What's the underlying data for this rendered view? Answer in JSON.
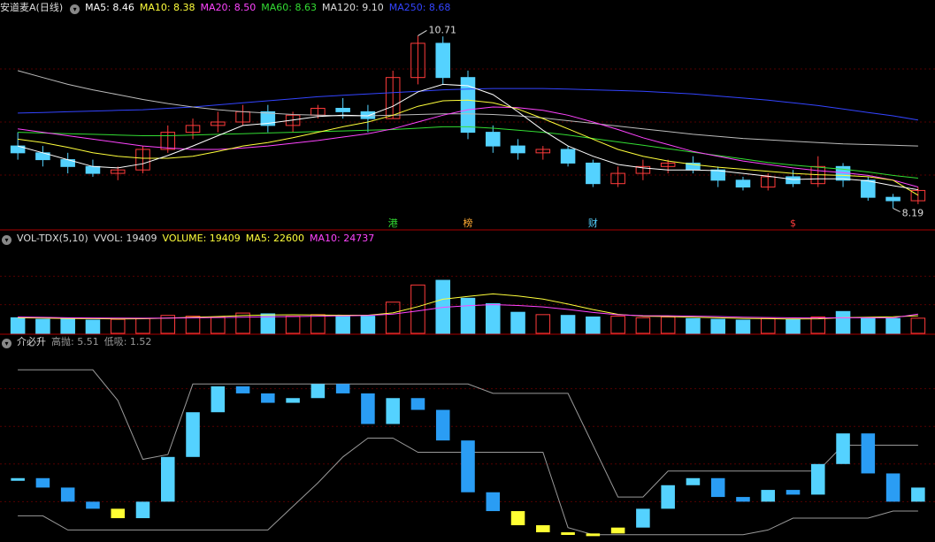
{
  "colors": {
    "up": "#ff3b3b",
    "down": "#54d2ff",
    "ma5": "#ffffff",
    "ma10": "#ffff3b",
    "ma20": "#ff44ff",
    "ma60": "#33dd33",
    "ma120": "#bbbbbb",
    "ma250": "#3344ff",
    "sep": "#aa0000",
    "grid": "#550000"
  },
  "main_header": {
    "title": "安道麦A(日线)",
    "ma5": "MA5: 8.46",
    "ma10": "MA10: 8.38",
    "ma20": "MA20: 8.50",
    "ma60": "MA60: 8.63",
    "ma120": "MA120: 9.10",
    "ma250": "MA250: 8.68"
  },
  "vol_header": {
    "title": "VOL-TDX(5,10)",
    "vvol": "VVOL: 19409",
    "volume": "VOLUME: 19409",
    "ma5": "MA5: 22600",
    "ma10": "MA10: 24737"
  },
  "ind_header": {
    "title": "介必升",
    "high": "高抛: 5.51",
    "low": "低吸: 1.52"
  },
  "markers": [
    {
      "label": "港",
      "color": "#33dd33",
      "index": 15
    },
    {
      "label": "榜",
      "color": "#ffaa33",
      "index": 18
    },
    {
      "label": "财",
      "color": "#54d2ff",
      "index": 23
    },
    {
      "label": "$",
      "color": "#ff3b3b",
      "index": 31
    }
  ],
  "chart_data": {
    "type": "candlestick",
    "price": {
      "max_label": "10.71",
      "min_label": "8.19",
      "ylim": [
        7.9,
        11.0
      ],
      "ohlc": [
        [
          9.1,
          9.3,
          8.9,
          9.0
        ],
        [
          9.0,
          9.1,
          8.8,
          8.9
        ],
        [
          8.9,
          9.0,
          8.7,
          8.8
        ],
        [
          8.8,
          8.9,
          8.65,
          8.7
        ],
        [
          8.7,
          8.8,
          8.6,
          8.75
        ],
        [
          8.75,
          9.1,
          8.7,
          9.05
        ],
        [
          9.05,
          9.4,
          9.0,
          9.3
        ],
        [
          9.3,
          9.5,
          9.2,
          9.4
        ],
        [
          9.4,
          9.6,
          9.3,
          9.45
        ],
        [
          9.45,
          9.7,
          9.4,
          9.6
        ],
        [
          9.6,
          9.7,
          9.3,
          9.4
        ],
        [
          9.4,
          9.6,
          9.3,
          9.55
        ],
        [
          9.55,
          9.7,
          9.5,
          9.65
        ],
        [
          9.65,
          9.8,
          9.5,
          9.6
        ],
        [
          9.6,
          9.7,
          9.3,
          9.5
        ],
        [
          9.5,
          10.2,
          9.5,
          10.1
        ],
        [
          10.1,
          10.71,
          10.0,
          10.6
        ],
        [
          10.6,
          10.7,
          10.0,
          10.1
        ],
        [
          10.1,
          10.2,
          9.2,
          9.3
        ],
        [
          9.3,
          9.4,
          9.0,
          9.1
        ],
        [
          9.1,
          9.2,
          8.9,
          9.0
        ],
        [
          9.0,
          9.1,
          8.9,
          9.05
        ],
        [
          9.05,
          9.1,
          8.8,
          8.85
        ],
        [
          8.85,
          8.9,
          8.5,
          8.55
        ],
        [
          8.55,
          8.8,
          8.5,
          8.7
        ],
        [
          8.7,
          8.9,
          8.6,
          8.8
        ],
        [
          8.8,
          8.9,
          8.7,
          8.85
        ],
        [
          8.85,
          8.95,
          8.7,
          8.75
        ],
        [
          8.75,
          8.8,
          8.5,
          8.6
        ],
        [
          8.6,
          8.65,
          8.45,
          8.5
        ],
        [
          8.5,
          8.7,
          8.45,
          8.65
        ],
        [
          8.65,
          8.75,
          8.5,
          8.55
        ],
        [
          8.55,
          8.95,
          8.5,
          8.8
        ],
        [
          8.8,
          8.85,
          8.5,
          8.6
        ],
        [
          8.6,
          8.65,
          8.3,
          8.35
        ],
        [
          8.35,
          8.4,
          8.19,
          8.3
        ],
        [
          8.3,
          8.5,
          8.25,
          8.45
        ]
      ],
      "ma5": [
        9.1,
        9.0,
        8.9,
        8.8,
        8.78,
        8.84,
        8.96,
        9.1,
        9.25,
        9.4,
        9.43,
        9.48,
        9.53,
        9.55,
        9.54,
        9.68,
        9.89,
        10.0,
        9.98,
        9.85,
        9.6,
        9.33,
        9.1,
        8.95,
        8.83,
        8.78,
        8.75,
        8.75,
        8.74,
        8.7,
        8.66,
        8.61,
        8.62,
        8.62,
        8.59,
        8.52,
        8.46
      ],
      "ma10": [
        9.2,
        9.15,
        9.08,
        9.0,
        8.95,
        8.92,
        8.92,
        8.95,
        9.02,
        9.1,
        9.15,
        9.22,
        9.3,
        9.38,
        9.45,
        9.55,
        9.68,
        9.76,
        9.77,
        9.73,
        9.64,
        9.5,
        9.35,
        9.2,
        9.05,
        8.95,
        8.88,
        8.83,
        8.79,
        8.76,
        8.73,
        8.7,
        8.68,
        8.67,
        8.65,
        8.6,
        8.38
      ],
      "ma20": [
        9.35,
        9.3,
        9.25,
        9.2,
        9.15,
        9.1,
        9.07,
        9.05,
        9.05,
        9.07,
        9.1,
        9.14,
        9.18,
        9.23,
        9.28,
        9.35,
        9.45,
        9.55,
        9.63,
        9.67,
        9.66,
        9.62,
        9.55,
        9.45,
        9.34,
        9.22,
        9.12,
        9.02,
        8.95,
        8.88,
        8.83,
        8.78,
        8.74,
        8.71,
        8.67,
        8.6,
        8.5
      ],
      "ma60": [
        9.3,
        9.29,
        9.28,
        9.27,
        9.26,
        9.25,
        9.25,
        9.26,
        9.27,
        9.28,
        9.29,
        9.3,
        9.31,
        9.32,
        9.33,
        9.34,
        9.36,
        9.38,
        9.38,
        9.36,
        9.33,
        9.3,
        9.26,
        9.21,
        9.16,
        9.11,
        9.06,
        9.01,
        8.96,
        8.91,
        8.86,
        8.82,
        8.79,
        8.76,
        8.72,
        8.67,
        8.63
      ],
      "ma120": [
        10.2,
        10.1,
        10.0,
        9.92,
        9.85,
        9.78,
        9.72,
        9.67,
        9.63,
        9.6,
        9.58,
        9.56,
        9.55,
        9.54,
        9.54,
        9.55,
        9.56,
        9.57,
        9.57,
        9.56,
        9.54,
        9.51,
        9.47,
        9.43,
        9.39,
        9.35,
        9.31,
        9.27,
        9.24,
        9.21,
        9.19,
        9.17,
        9.15,
        9.13,
        9.12,
        9.11,
        9.1
      ],
      "ma250": [
        9.58,
        9.59,
        9.6,
        9.61,
        9.62,
        9.63,
        9.65,
        9.67,
        9.7,
        9.73,
        9.76,
        9.79,
        9.82,
        9.84,
        9.86,
        9.88,
        9.9,
        9.92,
        9.93,
        9.94,
        9.94,
        9.94,
        9.93,
        9.92,
        9.91,
        9.9,
        9.88,
        9.86,
        9.83,
        9.8,
        9.77,
        9.73,
        9.69,
        9.64,
        9.59,
        9.54,
        9.48
      ]
    },
    "volume": {
      "ylim": [
        0,
        110000
      ],
      "values": [
        20000,
        18000,
        19000,
        17000,
        18000,
        19000,
        23000,
        22000,
        21000,
        26000,
        25000,
        22000,
        24000,
        23000,
        22000,
        40000,
        62000,
        68000,
        45000,
        38000,
        27000,
        24000,
        23000,
        21000,
        22000,
        20000,
        21000,
        19000,
        18000,
        17000,
        19000,
        18000,
        21000,
        28000,
        20000,
        19000,
        19409
      ],
      "ma5": [
        20000,
        19500,
        19000,
        18800,
        18500,
        18700,
        19500,
        20500,
        21500,
        22800,
        23500,
        23800,
        23600,
        23200,
        23200,
        26200,
        34200,
        43800,
        47400,
        50600,
        48000,
        44000,
        37500,
        30500,
        24400,
        22000,
        21600,
        20600,
        20000,
        19200,
        18800,
        18400,
        18600,
        20200,
        20800,
        21200,
        22600
      ],
      "ma10": [
        21000,
        20500,
        20000,
        19700,
        19500,
        19400,
        19500,
        19800,
        20300,
        20800,
        21200,
        21600,
        22000,
        22500,
        23000,
        24700,
        28800,
        33300,
        35500,
        36900,
        35700,
        33900,
        30600,
        26800,
        23800,
        22700,
        22600,
        22100,
        21600,
        20800,
        20300,
        19800,
        19700,
        20000,
        20000,
        19900,
        24737
      ]
    },
    "indicator": {
      "ylim": [
        0,
        8.0
      ],
      "high_label": "高抛: 5.51",
      "low_label": "低吸: 1.52",
      "values": [
        2.6,
        2.2,
        1.6,
        1.3,
        0.9,
        1.6,
        3.5,
        5.4,
        6.5,
        6.2,
        5.8,
        6.0,
        6.6,
        6.2,
        4.9,
        6.0,
        5.5,
        4.2,
        2.0,
        1.2,
        0.6,
        0.3,
        0.2,
        0.25,
        0.5,
        1.3,
        2.3,
        2.6,
        1.8,
        1.6,
        2.1,
        1.9,
        3.2,
        4.5,
        2.8,
        1.6,
        2.2
      ],
      "upper": [
        7.2,
        7.2,
        7.2,
        7.2,
        5.9,
        3.4,
        3.6,
        6.6,
        6.6,
        6.6,
        6.6,
        6.6,
        6.6,
        6.6,
        6.6,
        6.6,
        6.6,
        6.6,
        6.6,
        6.2,
        6.2,
        6.2,
        6.2,
        4.0,
        1.8,
        1.8,
        2.9,
        2.9,
        2.9,
        2.9,
        2.9,
        2.9,
        2.9,
        4.0,
        4.0,
        4.0,
        4.0
      ],
      "lower": [
        1.0,
        1.0,
        0.4,
        0.4,
        0.4,
        0.4,
        0.4,
        0.4,
        0.4,
        0.4,
        0.4,
        1.4,
        2.4,
        3.5,
        4.3,
        4.3,
        3.7,
        3.7,
        3.7,
        3.7,
        3.7,
        3.7,
        0.5,
        0.2,
        0.2,
        0.2,
        0.2,
        0.2,
        0.2,
        0.2,
        0.4,
        0.9,
        0.9,
        0.9,
        0.9,
        1.2,
        1.2
      ]
    }
  }
}
